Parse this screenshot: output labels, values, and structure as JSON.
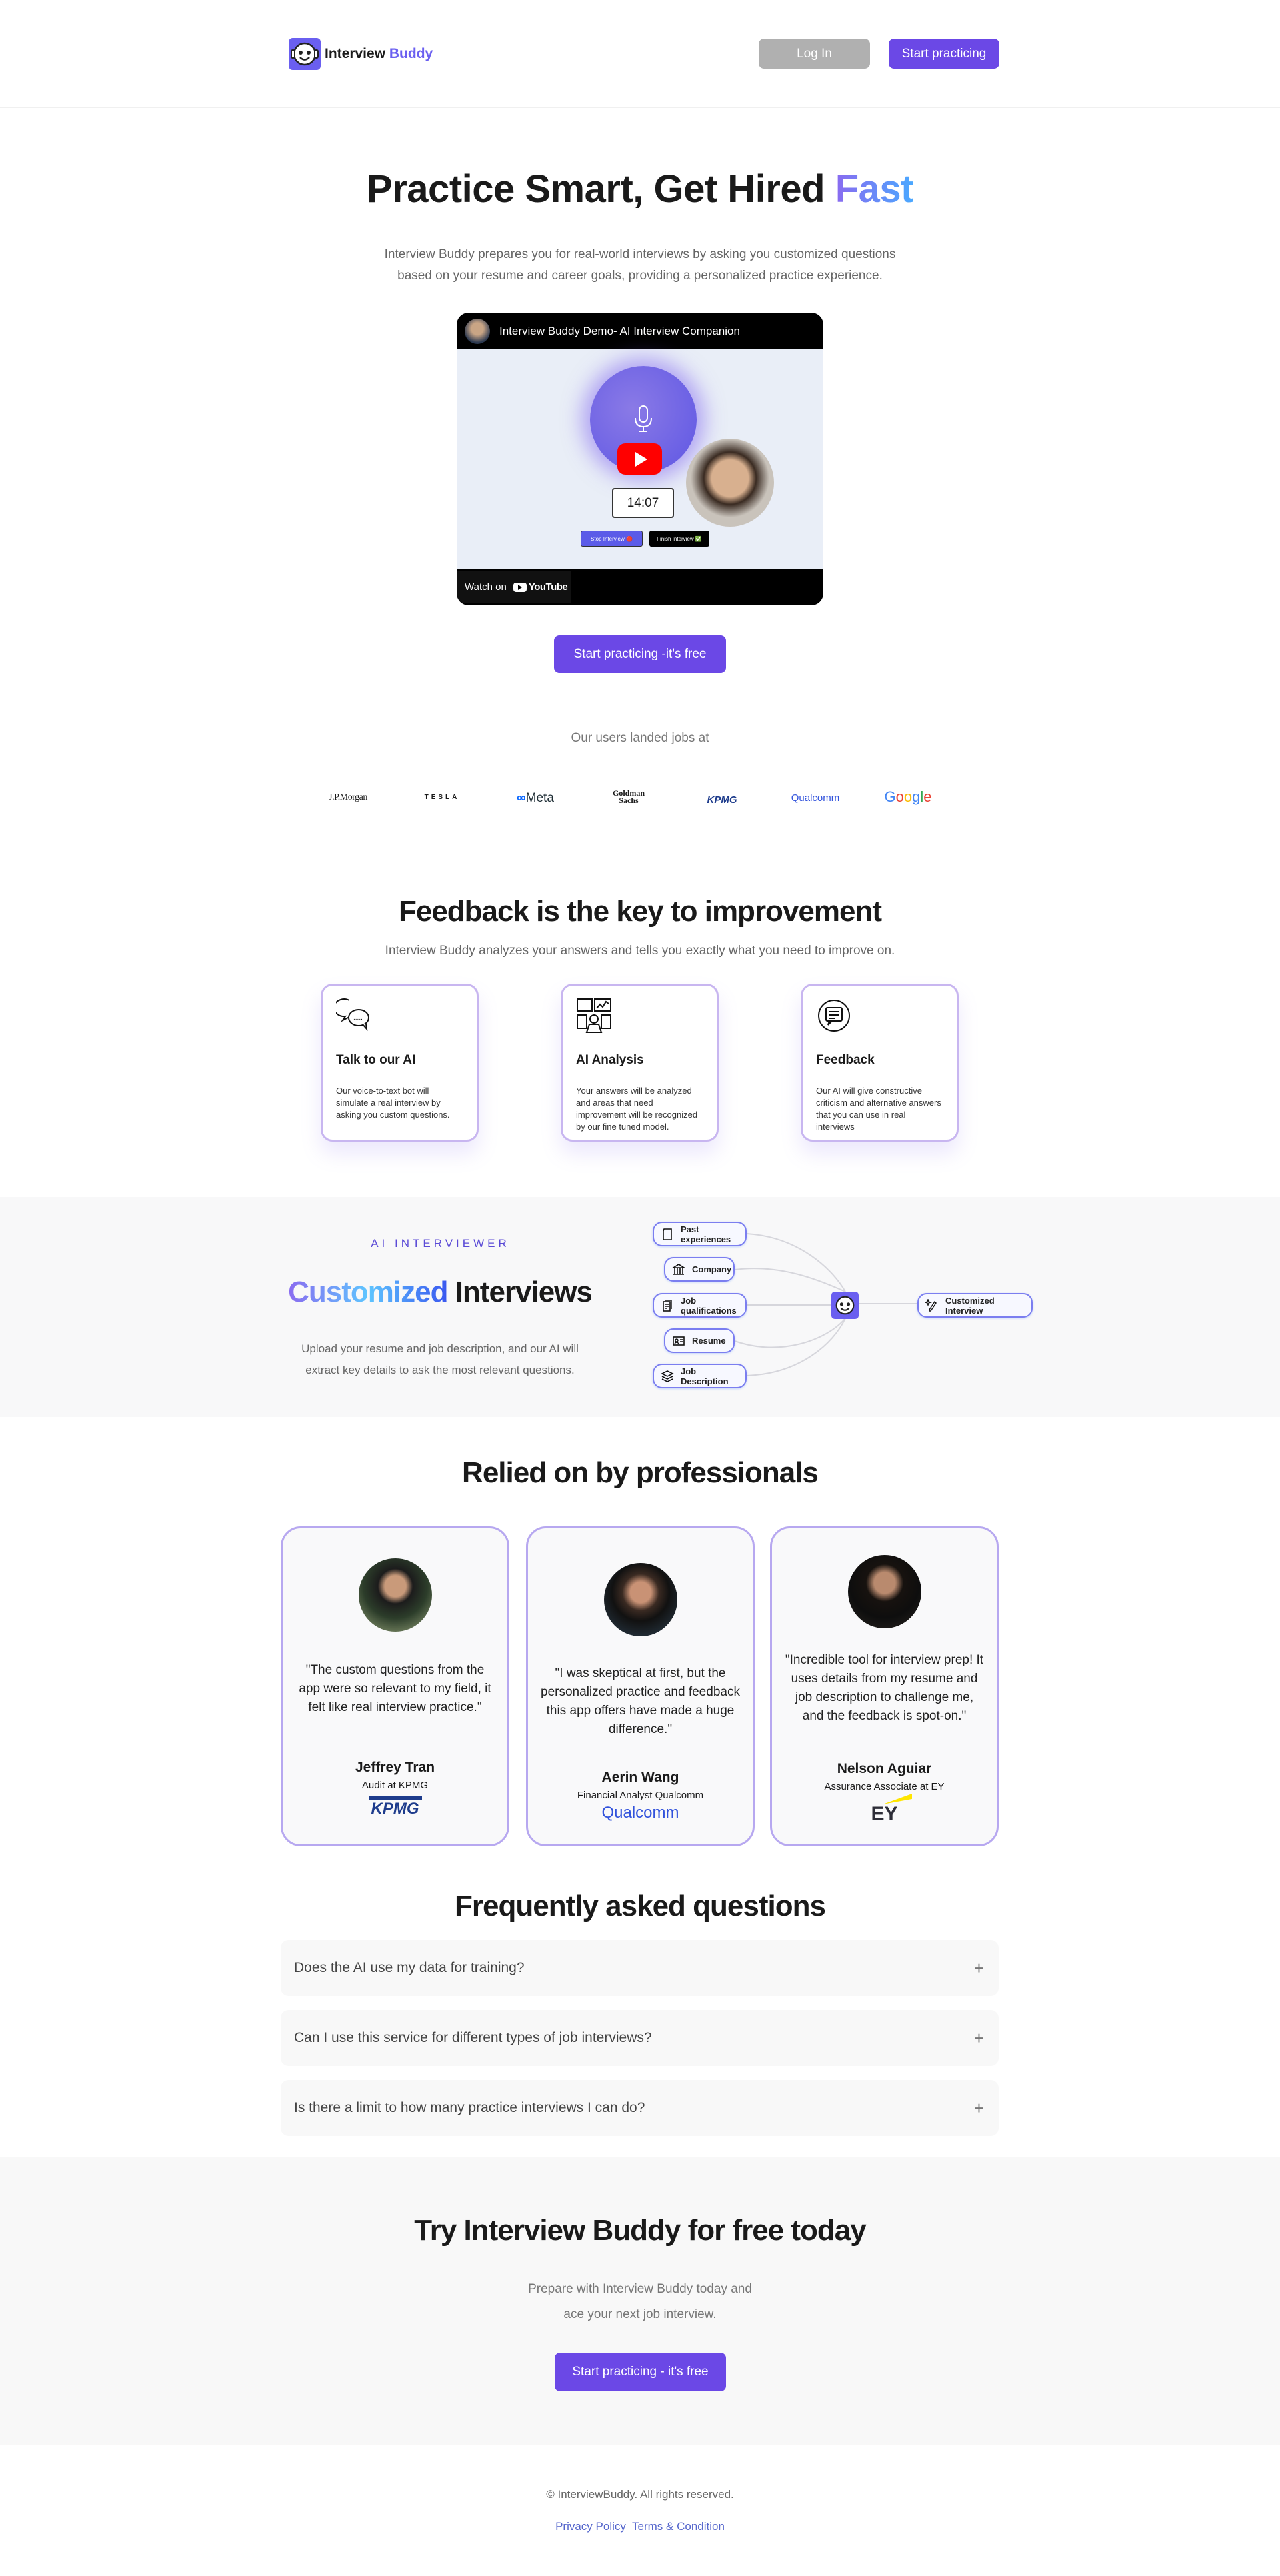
{
  "header": {
    "brand_first": "Interview",
    "brand_second": "Buddy",
    "login": "Log In",
    "start": "Start practicing"
  },
  "hero": {
    "title_main": "Practice Smart, Get Hired",
    "title_accent": "Fast",
    "subtitle_line1": "Interview Buddy prepares you for real-world interviews by asking you customized questions",
    "subtitle_line2": "based on your resume and career goals, providing a personalized practice experience.",
    "cta": "Start practicing -it's free"
  },
  "video": {
    "title": "Interview Buddy Demo- AI Interview Companion",
    "timer": "14:07",
    "stop": "Stop Interview",
    "finish": "Finish Interview",
    "watch_on": "Watch on",
    "youtube": "YouTube"
  },
  "logos": {
    "label": "Our users landed jobs at",
    "items": [
      "J.P.Morgan",
      "TESLA",
      "Meta",
      "Goldman Sachs",
      "KPMG",
      "Qualcomm",
      "Google"
    ]
  },
  "features": {
    "title": "Feedback is the key to improvement",
    "subtitle": "Interview Buddy analyzes your answers and tells you exactly what you need to improve on.",
    "cards": [
      {
        "icon": "chat-bubbles-icon",
        "title": "Talk to our AI",
        "desc": "Our voice-to-text bot will simulate a real interview by asking you custom questions."
      },
      {
        "icon": "analysis-dashboard-icon",
        "title": "AI Analysis",
        "desc": "Your answers will be analyzed and areas that need improvement will be recognized by our fine tuned model."
      },
      {
        "icon": "feedback-cycle-icon",
        "title": "Feedback",
        "desc": "Our AI will give constructive criticism and alternative answers that you can use in real interviews"
      }
    ]
  },
  "interviewer": {
    "eyebrow": "AI INTERVIEWER",
    "title_accent": "Customized",
    "title_rest": "Interviews",
    "desc_line1": "Upload your resume and job description, and our AI will",
    "desc_line2": "extract key details to ask the most relevant questions.",
    "inputs": [
      "Past experiences",
      "Company",
      "Job qualifications",
      "Resume",
      "Job Description"
    ],
    "output": "Customized Interview"
  },
  "testimonials": {
    "title": "Relied on by professionals",
    "items": [
      {
        "quote": "\"The custom questions from the app were so relevant to my field, it felt like real interview practice.\"",
        "name": "Jeffrey Tran",
        "role": "Audit at KPMG",
        "company": "KPMG"
      },
      {
        "quote": "\"I was skeptical at first, but the personalized practice and feedback this app offers have made a huge difference.\"",
        "name": "Aerin Wang",
        "role": "Financial Analyst Qualcomm",
        "company": "Qualcomm"
      },
      {
        "quote": "\"Incredible tool for interview prep! It uses details from my resume and job description to challenge me, and the feedback is spot-on.\"",
        "name": "Nelson Aguiar",
        "role": "Assurance Associate at EY",
        "company": "EY"
      }
    ]
  },
  "faq": {
    "title": "Frequently asked questions",
    "items": [
      "Does the AI use my data for training?",
      "Can I use this service for different types of job interviews?",
      "Is there a limit to how many practice interviews I can do?"
    ],
    "toggle": "+"
  },
  "cta": {
    "title": "Try Interview Buddy for free today",
    "line1": "Prepare with Interview Buddy today and",
    "line2": "ace your next job interview.",
    "button": "Start practicing - it's free"
  },
  "footer": {
    "copyright": "© InterviewBuddy. All rights reserved.",
    "privacy": "Privacy Policy",
    "terms": "Terms & Condition"
  },
  "colors": {
    "accent": "#6b48e6",
    "login_bg": "#b0b0b0",
    "card_border": "#c8b6f0",
    "section_bg": "#f8f8f9"
  }
}
